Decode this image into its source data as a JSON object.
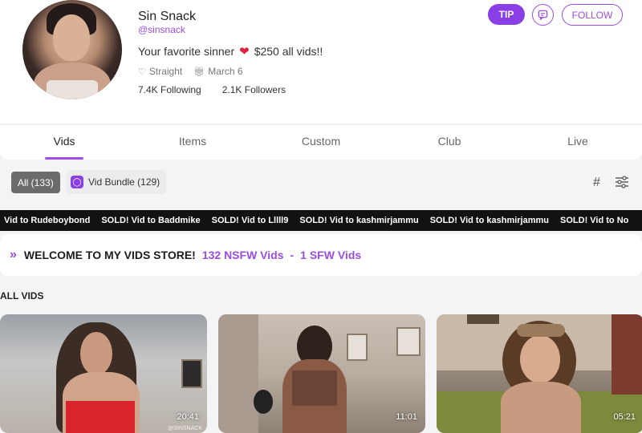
{
  "profile": {
    "name": "Sin Snack",
    "handle": "@sinsnack",
    "bio_text": "Your favorite sinner",
    "bio_price": "$250 all vids!!",
    "orientation": "Straight",
    "birthday": "March 6",
    "following": "7.4K Following",
    "followers": "2.1K Followers"
  },
  "actions": {
    "tip": "TIP",
    "follow": "FOLLOW"
  },
  "tabs": [
    {
      "label": "Vids",
      "active": true
    },
    {
      "label": "Items",
      "active": false
    },
    {
      "label": "Custom",
      "active": false
    },
    {
      "label": "Club",
      "active": false
    },
    {
      "label": "Live",
      "active": false
    }
  ],
  "filters": {
    "all": "All (133)",
    "bundle": "Vid Bundle (129)"
  },
  "ticker": [
    "Vid to Rudeboybond",
    "SOLD! Vid to Baddmike",
    "SOLD! Vid to Lllll9",
    "SOLD! Vid to kashmirjammu",
    "SOLD! Vid to kashmirjammu",
    "SOLD! Vid to No"
  ],
  "welcome": {
    "title": "WELCOME TO MY VIDS STORE!",
    "nsfw": "132 NSFW Vids",
    "sep": "-",
    "sfw": "1 SFW Vids"
  },
  "section": {
    "title": "ALL VIDS"
  },
  "videos": [
    {
      "duration": "20:41",
      "watermark": "@SINSNACK"
    },
    {
      "duration": "11:01"
    },
    {
      "duration": "05:21"
    }
  ],
  "colors": {
    "accent": "#9b4de0",
    "tip_bg": "#8a3ee6",
    "ticker_bg": "#121212",
    "heart": "#e0213a"
  }
}
